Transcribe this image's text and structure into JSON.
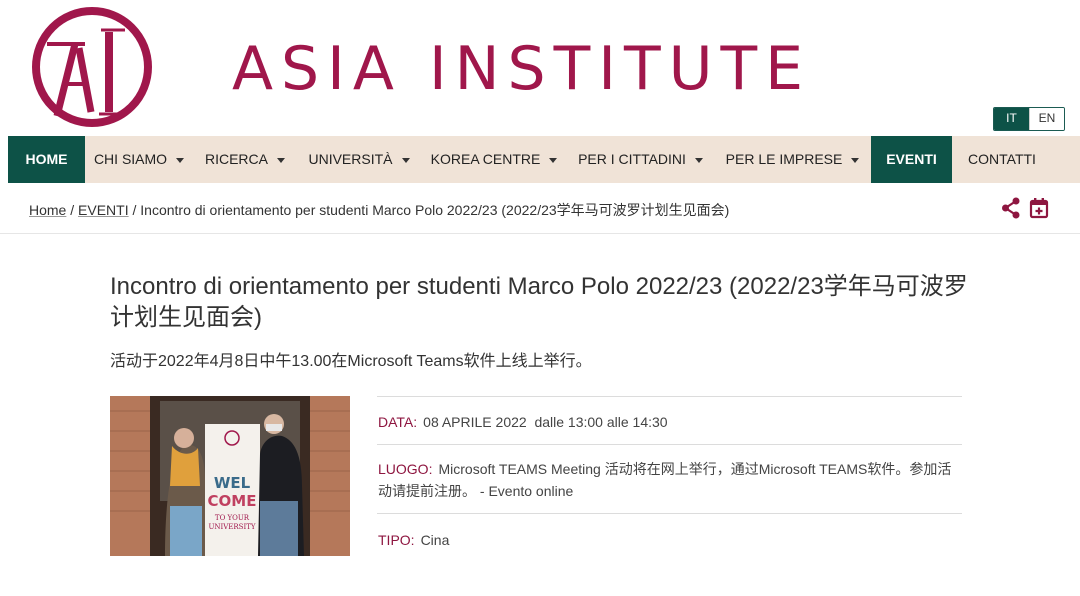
{
  "site": {
    "logo_letters": "AI",
    "title": "ASIA INSTITUTE"
  },
  "language": {
    "active": "IT",
    "other": "EN"
  },
  "nav": {
    "items": [
      {
        "label": "HOME",
        "active": true,
        "dropdown": false
      },
      {
        "label": "CHI SIAMO",
        "active": false,
        "dropdown": true
      },
      {
        "label": "RICERCA",
        "active": false,
        "dropdown": true
      },
      {
        "label": "UNIVERSITÀ",
        "active": false,
        "dropdown": true
      },
      {
        "label": "KOREA CENTRE",
        "active": false,
        "dropdown": true
      },
      {
        "label": "PER I CITTADINI",
        "active": false,
        "dropdown": true
      },
      {
        "label": "PER LE IMPRESE",
        "active": false,
        "dropdown": true
      },
      {
        "label": "EVENTI",
        "active": true,
        "dropdown": false
      },
      {
        "label": "CONTATTI",
        "active": false,
        "dropdown": false
      }
    ]
  },
  "breadcrumb": {
    "home": "Home",
    "section": "EVENTI",
    "separator": "/",
    "current": "Incontro di orientamento per studenti Marco Polo 2022/23 (2022/23学年马可波罗计划生见面会)"
  },
  "icons": {
    "share": "share-icon",
    "calendar": "calendar-add-icon"
  },
  "event": {
    "title": "Incontro di orientamento per studenti Marco Polo 2022/23 (2022/23学年马可波罗计划生见面会)",
    "subtitle": "活动于2022年4月8日中午13.00在Microsoft Teams软件上线上举行。",
    "photo": {
      "banner_line1": "WEL",
      "banner_line2": "COME",
      "banner_line3": "TO YOUR",
      "banner_line4": "UNIVERSITY"
    },
    "data_label": "DATA:",
    "data_value": "08 APRILE 2022  dalle 13:00 alle 14:30",
    "luogo_label": "LUOGO:",
    "luogo_value": "Microsoft TEAMS Meeting 活动将在网上举行，通过Microsoft TEAMS软件。参加活动请提前注册。 - Evento online",
    "tipo_label": "TIPO:",
    "tipo_value": "Cina"
  },
  "colors": {
    "brand": "#a0174b",
    "nav_active": "#0d5247",
    "nav_bg": "#f0e3d7",
    "label": "#8e1640"
  }
}
